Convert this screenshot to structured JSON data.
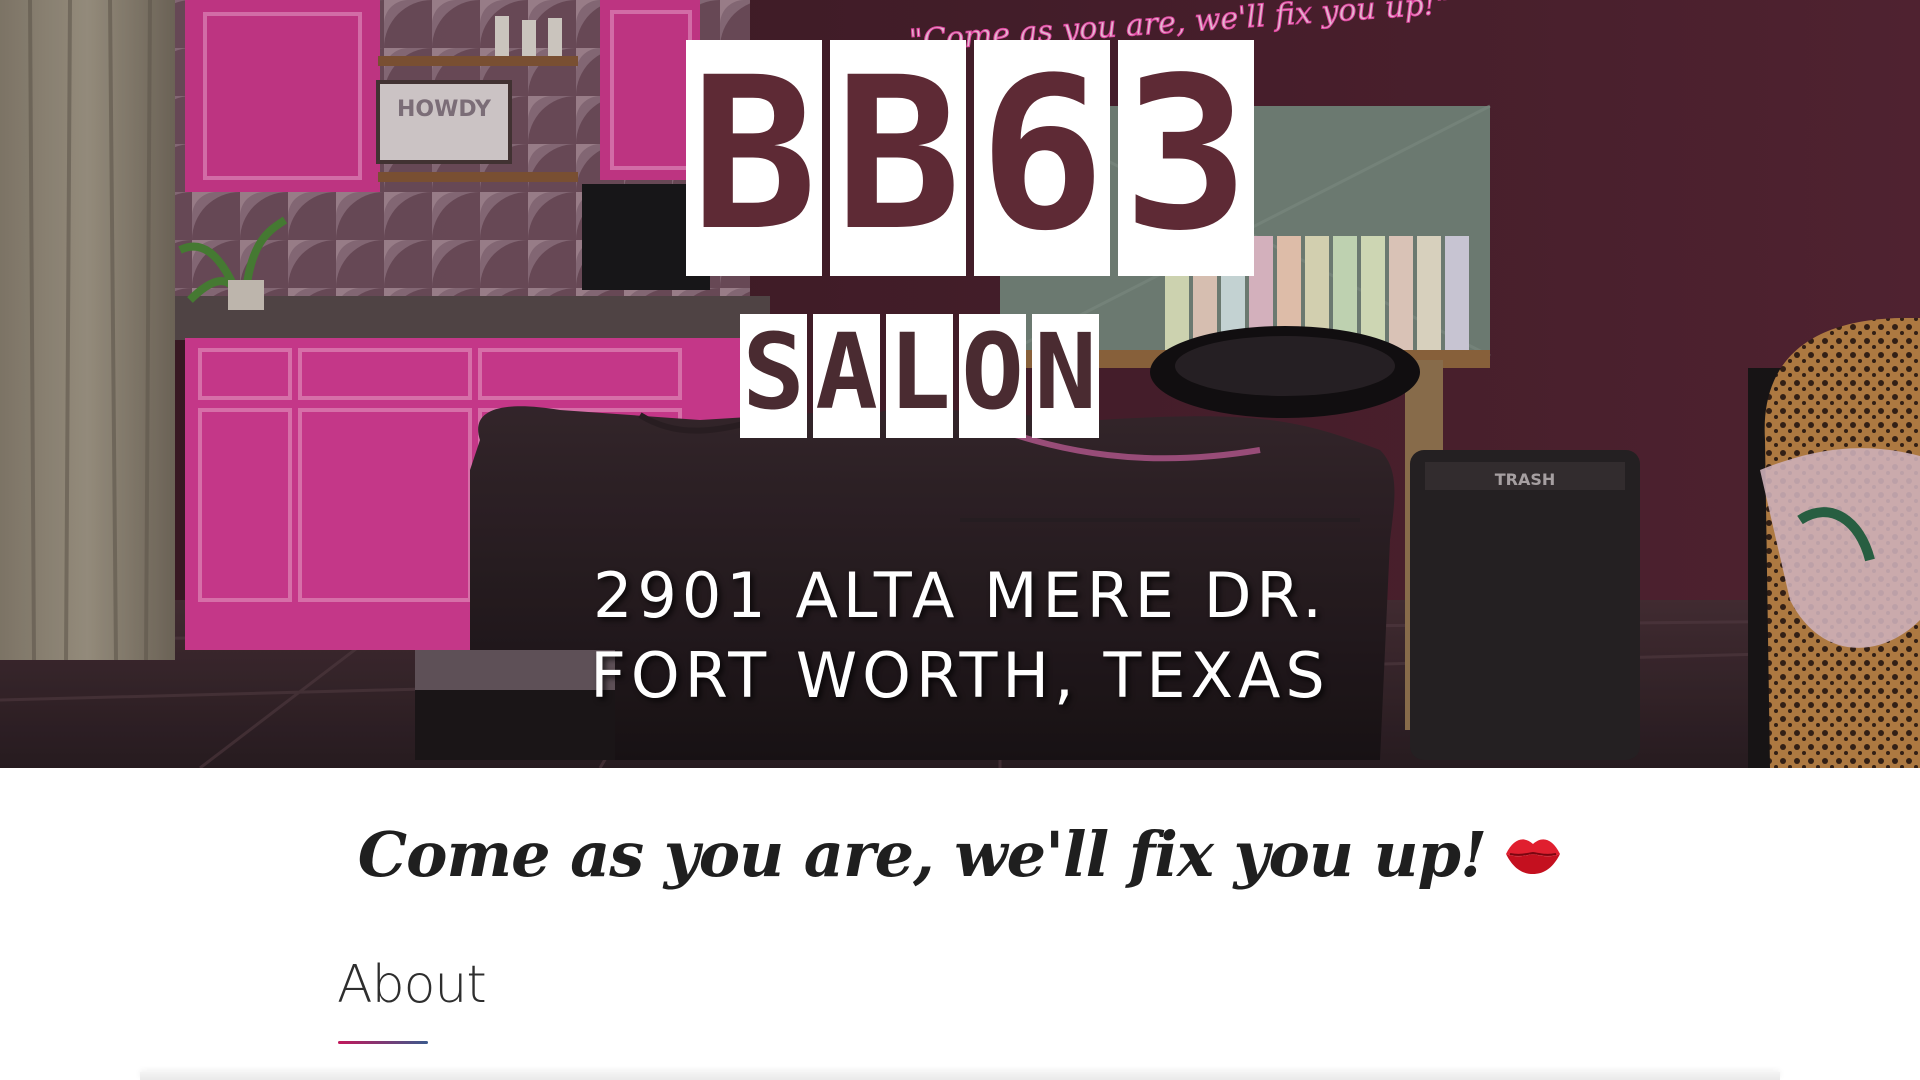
{
  "hero": {
    "logo_top": [
      "B",
      "B",
      "6",
      "3"
    ],
    "logo_bottom": [
      "S",
      "A",
      "L",
      "O",
      "N"
    ],
    "neon_sign": "\"Come as you are, we'll fix you up!\"",
    "sign_howdy": "HOWDY",
    "sign_trash": "TRASH",
    "address_line1": "2901 ALTA MERE DR.",
    "address_line2": "FORT WORTH, TEXAS"
  },
  "tagline": {
    "text": "Come as you are, we'll fix you up!",
    "icon": "lips-kiss-icon"
  },
  "about": {
    "title": "About"
  },
  "colors": {
    "cabinet_pink": "#e0409a",
    "wall_plum": "#4a2030",
    "logo_maroon": "#5e2a35",
    "rule_gradient_start": "#c2185b",
    "rule_gradient_end": "#3a5a8c"
  }
}
